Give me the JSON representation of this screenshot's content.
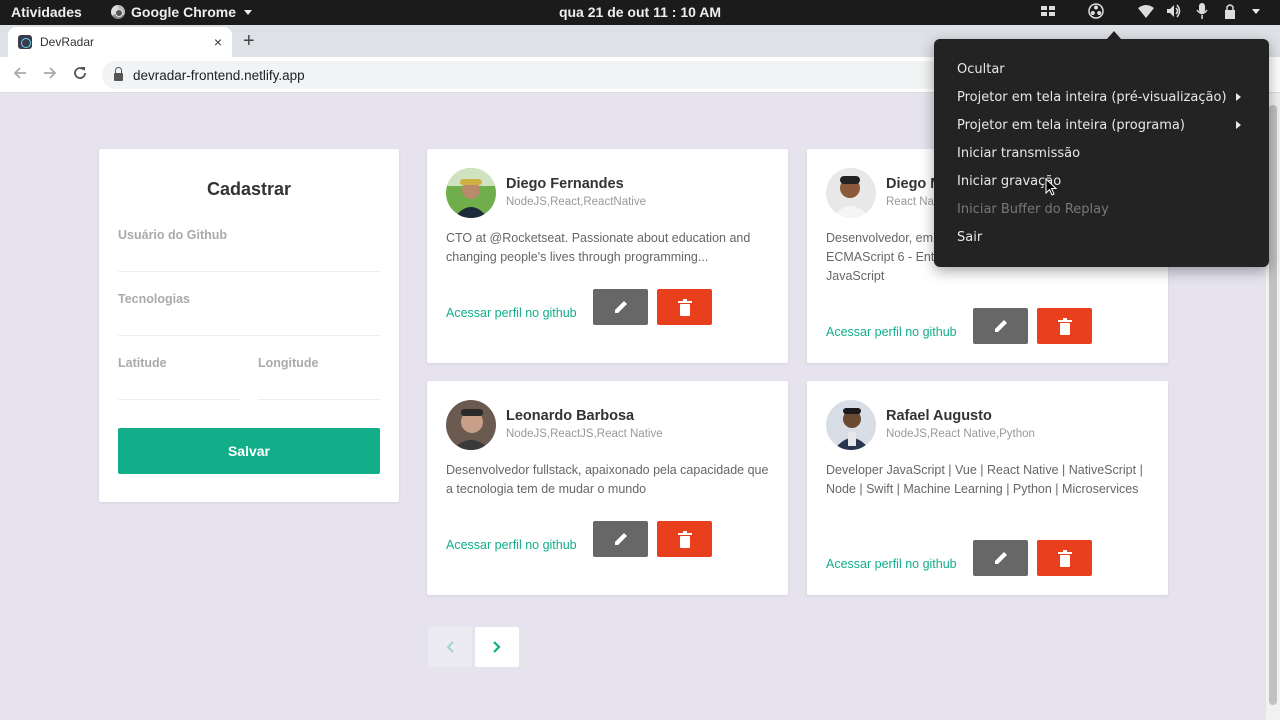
{
  "topbar": {
    "activities": "Atividades",
    "app_name": "Google Chrome",
    "clock": "qua 21 de out  11 : 10 AM"
  },
  "browser": {
    "tab_title": "DevRadar",
    "tab_close": "×",
    "new_tab": "+",
    "url": "devradar-frontend.netlify.app"
  },
  "form": {
    "title": "Cadastrar",
    "github_user_placeholder": "Usuário do Github",
    "techs_placeholder": "Tecnologias",
    "latitude_placeholder": "Latitude",
    "longitude_placeholder": "Longitude",
    "save_label": "Salvar"
  },
  "devs": [
    {
      "name": "Diego Fernandes",
      "techs": "NodeJS,React,ReactNative",
      "bio": "CTO at @Rocketseat. Passionate about education and changing people's lives through programming...",
      "github_link": "Acessar perfil no github"
    },
    {
      "name": "Diego M",
      "techs": "React Na",
      "bio": "Desenvolvedor, em ECMAScript 6 - Ent JavaScript",
      "github_link": "Acessar perfil no github"
    },
    {
      "name": "Leonardo Barbosa",
      "techs": "NodeJS,ReactJS,React Native",
      "bio": "Desenvolvedor fullstack, apaixonado pela capacidade que a tecnologia tem de mudar o mundo",
      "github_link": "Acessar perfil no github"
    },
    {
      "name": "Rafael Augusto",
      "techs": "NodeJS,React Native,Python",
      "bio": "Developer JavaScript | Vue | React Native | NativeScript | Node | Swift | Machine Learning | Python | Microservices",
      "github_link": "Acessar perfil no github"
    }
  ],
  "obs_menu": {
    "items": [
      {
        "label": "Ocultar"
      },
      {
        "label": "Projetor em tela inteira (pré-visualização)"
      },
      {
        "label": "Projetor em tela inteira (programa)"
      },
      {
        "label": "Iniciar transmissão"
      },
      {
        "label": "Iniciar gravação"
      },
      {
        "label": "Iniciar Buffer do Replay"
      },
      {
        "label": "Sair"
      }
    ]
  },
  "colors": {
    "accent": "#11ae89",
    "edit": "#676767",
    "delete": "#e8401c",
    "page_bg": "#e6e3ef"
  }
}
